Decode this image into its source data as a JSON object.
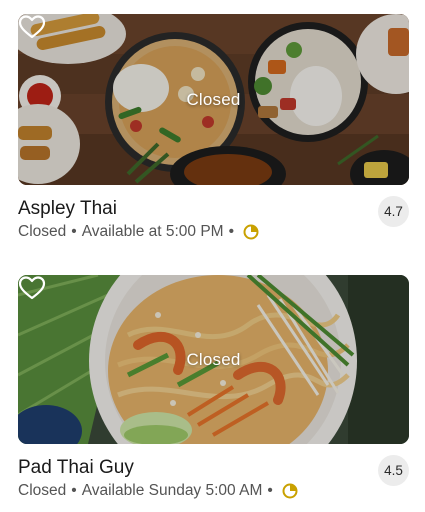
{
  "restaurants": [
    {
      "name": "Aspley Thai",
      "overlay_label": "Closed",
      "status": "Closed",
      "availability": "Available at 5:00 PM",
      "separator": "•",
      "rating": "4.7",
      "favorited": false,
      "badge_icon": "uber-one-icon",
      "badge_color": "#c9a100"
    },
    {
      "name": "Pad Thai Guy",
      "overlay_label": "Closed",
      "status": "Closed",
      "availability": "Available Sunday 5:00 AM",
      "separator": "•",
      "rating": "4.5",
      "favorited": false,
      "badge_icon": "uber-one-icon",
      "badge_color": "#c9a100"
    }
  ]
}
